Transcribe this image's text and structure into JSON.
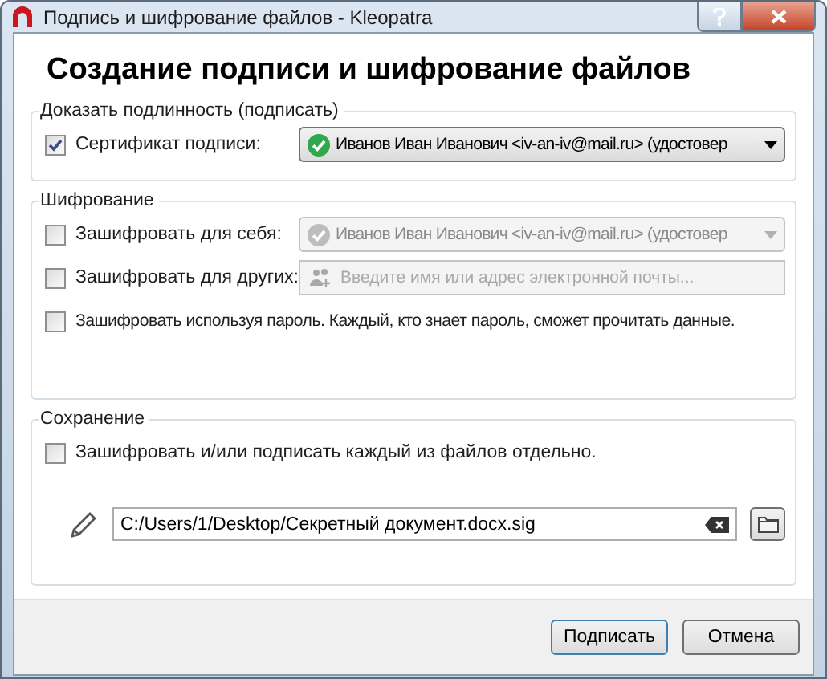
{
  "window": {
    "title": "Подпись и шифрование файлов - Kleopatra"
  },
  "heading": "Создание подписи и шифрование файлов",
  "sign": {
    "legend": "Доказать подлинность (подписать)",
    "checkbox": {
      "label": "Сертификат подписи:",
      "checked": true
    },
    "combo": {
      "value": "Иванов Иван Иванович <iv-an-iv@mail.ru> (удостовер",
      "disabled": false
    }
  },
  "encrypt": {
    "legend": "Шифрование",
    "self": {
      "checkbox": {
        "label": "Зашифровать для себя:",
        "checked": false
      },
      "combo": {
        "value": "Иванов Иван Иванович <iv-an-iv@mail.ru> (удостовер",
        "disabled": true
      }
    },
    "others": {
      "checkbox": {
        "label": "Зашифровать для других:",
        "checked": false
      },
      "field": {
        "placeholder": "Введите имя или адрес электронной почты...",
        "disabled": true
      }
    },
    "password": {
      "label": "Зашифровать используя пароль. Каждый, кто знает пароль, сможет прочитать данные.",
      "checked": false
    }
  },
  "output": {
    "legend": "Сохранение",
    "checkbox": {
      "label": "Зашифровать и/или подписать каждый из файлов отдельно.",
      "checked": false
    },
    "path": {
      "value": "C:/Users/1/Desktop/Секретный документ.docx.sig"
    }
  },
  "buttons": [
    {
      "label": "Подписать"
    },
    {
      "label": "Отмена"
    }
  ]
}
